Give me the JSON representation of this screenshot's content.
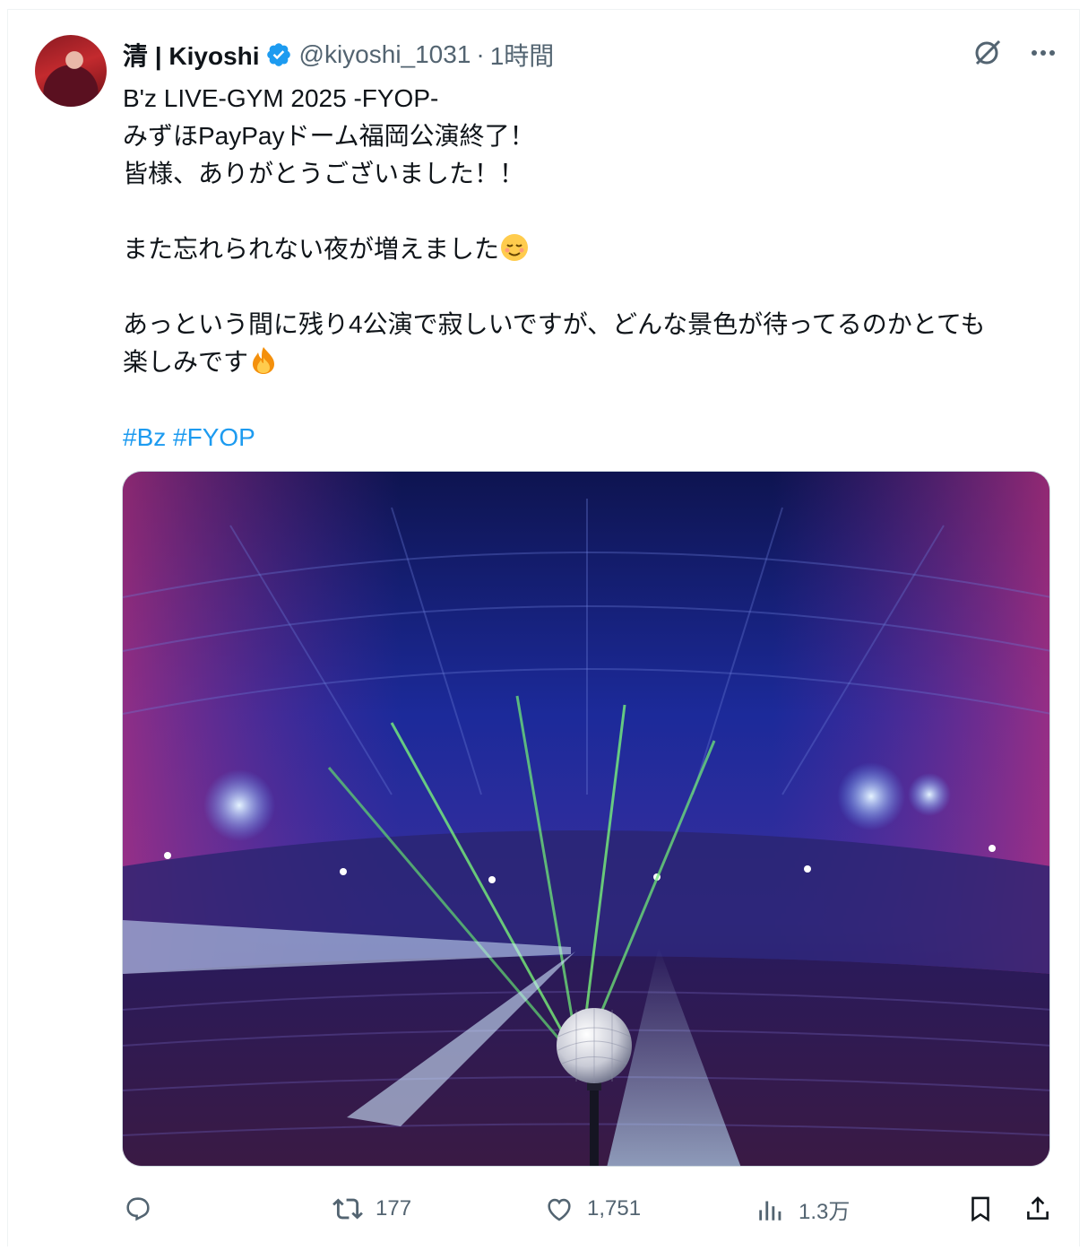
{
  "post": {
    "display_name": "清 | Kiyoshi",
    "handle": "@kiyoshi_1031",
    "separator": "·",
    "time": "1時間",
    "verified": true,
    "lines": [
      "B'z LIVE-GYM 2025 -FYOP-",
      "みずほPayPayドーム福岡公演終了！",
      "皆様、ありがとうございました！！",
      "",
      "また忘れられない夜が増えました",
      "",
      "あっという間に残り4公演で寂しいですが、どんな景色が待ってるのかとても",
      "楽しみです",
      ""
    ],
    "emoji_1": "relieved-face",
    "emoji_2": "fire",
    "hashtags": "#Bz #FYOP",
    "image_alt_semantic": "dome-concert-stage-microphone-photo"
  },
  "top_icons": [
    "grok-icon",
    "more-icon"
  ],
  "actions": {
    "reply_count": "",
    "repost_count": "177",
    "like_count": "1,751",
    "views_count": "1.3万"
  },
  "colors": {
    "accent": "#1d9bf0",
    "muted": "#536471",
    "text": "#0f1419"
  }
}
